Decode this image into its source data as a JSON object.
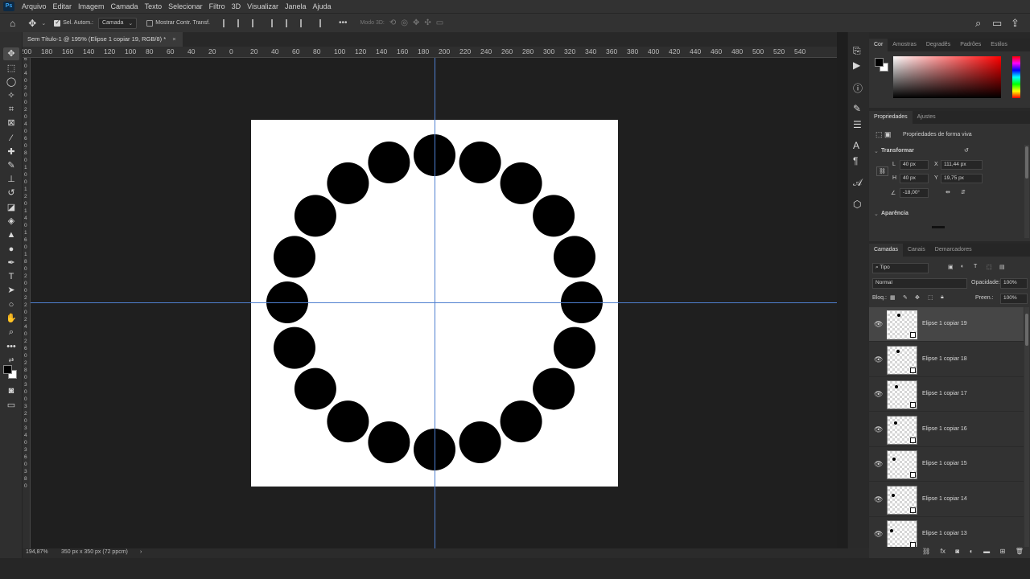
{
  "app_logo": "Ps",
  "menu": [
    "Arquivo",
    "Editar",
    "Imagem",
    "Camada",
    "Texto",
    "Selecionar",
    "Filtro",
    "3D",
    "Visualizar",
    "Janela",
    "Ajuda"
  ],
  "options_bar": {
    "auto_select_label": "Sel. Autom.:",
    "auto_select_checked": true,
    "target_value": "Camada",
    "show_transform_label": "Mostrar Contr. Transf.",
    "show_transform_checked": false,
    "more": "•••",
    "mode3d_label": "Modo 3D:"
  },
  "document_tab": {
    "title": "Sem Título-1 @ 195% (Elipse 1 copiar 19, RGB/8) *",
    "close": "×"
  },
  "ruler_top": [
    "200",
    "180",
    "160",
    "140",
    "120",
    "100",
    "80",
    "60",
    "40",
    "20",
    "0",
    "20",
    "40",
    "60",
    "80",
    "100",
    "120",
    "140",
    "160",
    "180",
    "200",
    "220",
    "240",
    "260",
    "280",
    "300",
    "320",
    "340",
    "360",
    "380",
    "400",
    "420",
    "440",
    "460",
    "480",
    "500",
    "520",
    "540"
  ],
  "ruler_left": [
    "6",
    "0",
    "4",
    "0",
    "2",
    "0",
    "0",
    "2",
    "0",
    "4",
    "0",
    "6",
    "0",
    "8",
    "0",
    "1",
    "0",
    "0",
    "1",
    "2",
    "0",
    "1",
    "4",
    "0",
    "1",
    "6",
    "0",
    "1",
    "8",
    "0",
    "2",
    "0",
    "0",
    "2",
    "2",
    "0",
    "2",
    "4",
    "0",
    "2",
    "6",
    "0",
    "2",
    "8",
    "0",
    "3",
    "0",
    "0",
    "3",
    "2",
    "0",
    "3",
    "4",
    "0",
    "3",
    "6",
    "0",
    "3",
    "8",
    "0"
  ],
  "canvas": {
    "document_size": "350 px x 350 px",
    "circle_count": 20,
    "circle_color": "#000000",
    "background": "#ffffff",
    "guide_color": "#4f7fd0"
  },
  "status": {
    "zoom": "194,87%",
    "doc_info": "350 px x 350 px (72 ppcm)",
    "arrow": "›"
  },
  "color_panel": {
    "tabs": [
      "Cor",
      "Amostras",
      "Degradês",
      "Padrões",
      "Estilos"
    ],
    "active_tab": "Cor"
  },
  "properties_panel": {
    "tabs": [
      "Propriedades",
      "Ajustes"
    ],
    "active_tab": "Propriedades",
    "kind": "Propriedades de forma viva",
    "transform_header": "Transformar",
    "w_label": "L",
    "w_value": "40 px",
    "x_label": "X",
    "x_value": "111,44 px",
    "h_label": "H",
    "h_value": "40 px",
    "y_label": "Y",
    "y_value": "19,75 px",
    "angle_value": "-18,00°",
    "appearance_header": "Aparência"
  },
  "layers_panel": {
    "tabs": [
      "Camadas",
      "Canais",
      "Demarcadores"
    ],
    "active_tab": "Camadas",
    "filter_label": "Tipo",
    "blend_mode": "Normal",
    "opacity_label": "Opacidade:",
    "opacity_value": "100%",
    "lock_label": "Bloq.:",
    "fill_label": "Preen.:",
    "fill_value": "100%",
    "layers": [
      {
        "name": "Elipse 1 copiar 19",
        "selected": true
      },
      {
        "name": "Elipse 1 copiar 18",
        "selected": false
      },
      {
        "name": "Elipse 1 copiar 17",
        "selected": false
      },
      {
        "name": "Elipse 1 copiar 16",
        "selected": false
      },
      {
        "name": "Elipse 1 copiar 15",
        "selected": false
      },
      {
        "name": "Elipse 1 copiar 14",
        "selected": false
      },
      {
        "name": "Elipse 1 copiar 13",
        "selected": false
      }
    ]
  }
}
